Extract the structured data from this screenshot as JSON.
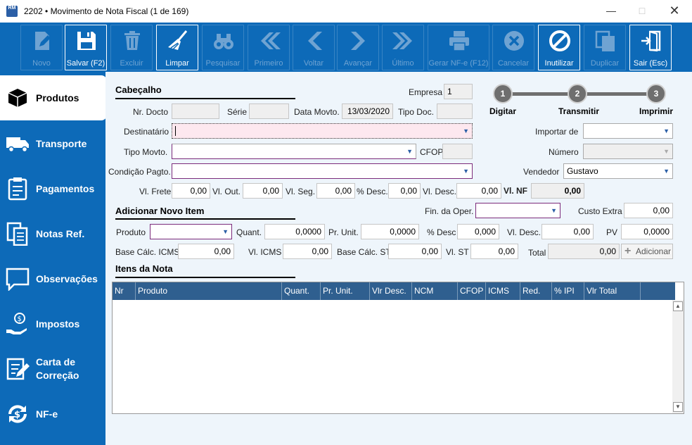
{
  "window": {
    "title": "2202 • Movimento de Nota Fiscal (1 de 169)",
    "app_icon_text": "RM"
  },
  "toolbar": {
    "novo": "Novo",
    "salvar": "Salvar (F2)",
    "excluir": "Excluir",
    "limpar": "Limpar",
    "pesquisar": "Pesquisar",
    "primeiro": "Primeiro",
    "voltar": "Voltar",
    "avancar": "Avançar",
    "ultimo": "Último",
    "gerar_nfe": "Gerar NF-e (F12)",
    "cancelar": "Cancelar",
    "inutilizar": "Inutilizar",
    "duplicar": "Duplicar",
    "sair": "Sair (Esc)"
  },
  "sidebar": {
    "produtos": "Produtos",
    "transporte": "Transporte",
    "pagamentos": "Pagamentos",
    "notas_ref": "Notas Ref.",
    "observacoes": "Observações",
    "impostos": "Impostos",
    "carta_1": "Carta de",
    "carta_2": "Correção",
    "nfe": "NF-e"
  },
  "cabecalho": {
    "title": "Cabeçalho",
    "empresa_label": "Empresa",
    "empresa_value": "1",
    "nr_docto_label": "Nr. Docto",
    "serie_label": "Série",
    "data_label": "Data Movto.",
    "data_value": "13/03/2020",
    "tipo_doc_label": "Tipo Doc.",
    "destinatario_label": "Destinatário",
    "tipo_movto_label": "Tipo Movto.",
    "cfop_label": "CFOP",
    "condicao_label": "Condição Pagto.",
    "importar_label": "Importar de",
    "numero_label": "Número",
    "vendedor_label": "Vendedor",
    "vendedor_value": "Gustavo",
    "vl_frete_label": "Vl. Frete",
    "vl_frete": "0,00",
    "vl_out_label": "Vl. Out.",
    "vl_out": "0,00",
    "vl_seg_label": "Vl. Seg.",
    "vl_seg": "0,00",
    "pct_desc_label": "% Desc.",
    "pct_desc": "0,00",
    "vl_desc_label": "Vl. Desc.",
    "vl_desc": "0,00",
    "vl_nf_label": "Vl. NF",
    "vl_nf": "0,00"
  },
  "steps": {
    "s1": "1",
    "s2": "2",
    "s3": "3",
    "digitar": "Digitar",
    "transmitir": "Transmitir",
    "imprimir": "Imprimir"
  },
  "item": {
    "title": "Adicionar Novo Item",
    "fin_oper_label": "Fin. da Oper.",
    "custo_extra_label": "Custo Extra",
    "custo_extra": "0,00",
    "produto_label": "Produto",
    "quant_label": "Quant.",
    "quant": "0,0000",
    "pr_unit_label": "Pr. Unit.",
    "pr_unit": "0,0000",
    "pct_desc_label": "% Desc",
    "pct_desc": "0,000",
    "vl_desc_label": "Vl. Desc.",
    "vl_desc": "0,00",
    "pv_label": "PV",
    "pv": "0,0000",
    "base_icms_label": "Base Cálc. ICMS",
    "base_icms": "0,00",
    "vl_icms_label": "Vl. ICMS",
    "vl_icms": "0,00",
    "base_st_label": "Base Cálc. ST",
    "base_st": "0,00",
    "vl_st_label": "Vl. ST",
    "vl_st": "0,00",
    "total_label": "Total",
    "total": "0,00",
    "adicionar": "Adicionar"
  },
  "itens": {
    "title": "Itens da Nota",
    "columns": [
      "Nr",
      "Produto",
      "Quant.",
      "Pr. Unit.",
      "Vlr Desc.",
      "NCM",
      "CFOP",
      "ICMS",
      "Red.",
      "% IPI",
      "Vlr Total"
    ]
  }
}
